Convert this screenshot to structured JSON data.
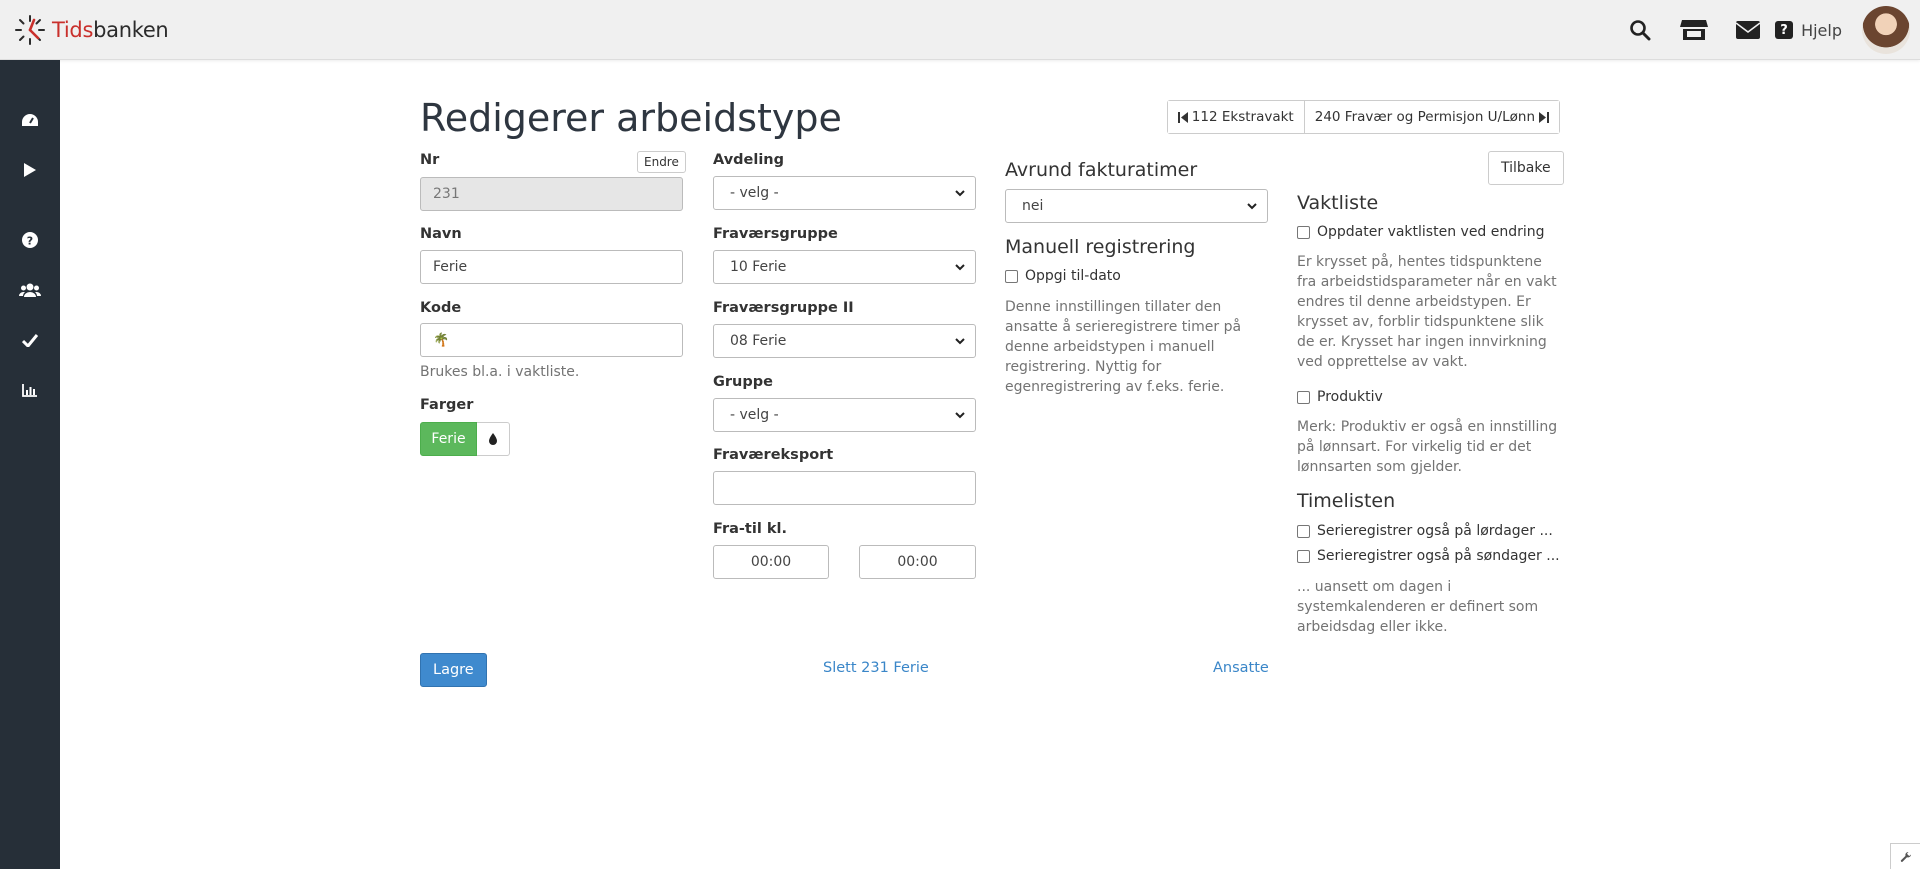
{
  "app": {
    "logo_prefix": "Tids",
    "logo_suffix": "banken",
    "help_label": "Hjelp"
  },
  "topbar": {
    "icons": [
      "search-icon",
      "store-icon",
      "mail-icon",
      "help-icon"
    ]
  },
  "sidebar": {
    "items": [
      "dashboard-icon",
      "play-icon",
      "help-circle-icon",
      "users-icon",
      "check-icon",
      "chart-icon"
    ]
  },
  "page": {
    "title": "Redigerer arbeidstype",
    "prev_label": "112 Ekstravakt",
    "next_label": "240 Fravær og Permisjon U/Lønn",
    "back_label": "Tilbake"
  },
  "form": {
    "nr_label": "Nr",
    "nr_value": "231",
    "endre_label": "Endre",
    "navn_label": "Navn",
    "navn_value": "Ferie",
    "kode_label": "Kode",
    "kode_value": "🌴",
    "kode_help": "Brukes bl.a. i vaktliste.",
    "farger_label": "Farger",
    "color_label": "Ferie",
    "color_value": "#5cb85c",
    "avdeling_label": "Avdeling",
    "avdeling_value": "- velg -",
    "fravaersgruppe_label": "Fraværsgruppe",
    "fravaersgruppe_value": "10 Ferie",
    "fravaersgruppe2_label": "Fraværsgruppe II",
    "fravaersgruppe2_value": "08 Ferie",
    "gruppe_label": "Gruppe",
    "gruppe_value": "- velg -",
    "eksport_label": "Fraværeksport",
    "eksport_value": "",
    "fratil_label": "Fra-til kl.",
    "fra_value": "00:00",
    "til_value": "00:00"
  },
  "billing": {
    "title": "Avrund fakturatimer",
    "value": "nei",
    "manual_title": "Manuell registrering",
    "manual_check": "Oppgi til-dato",
    "manual_help": "Denne innstillingen tillater den ansatte å serieregistrere timer på denne arbeidstypen i manuell registrering. Nyttig for egenregistrering av f.eks. ferie."
  },
  "vaktliste": {
    "title": "Vaktliste",
    "update_check": "Oppdater vaktlisten ved endring",
    "update_help": "Er krysset på, hentes tidspunktene fra arbeidstidsparameter når en vakt endres til denne arbeidstypen. Er krysset av, forblir tidspunktene slik de er. Krysset har ingen innvirkning ved opprettelse av vakt.",
    "produktiv_check": "Produktiv",
    "produktiv_help": "Merk: Produktiv er også en innstilling på lønnsart. For virkelig tid er det lønnsarten som gjelder."
  },
  "timelisten": {
    "title": "Timelisten",
    "saturday_check": "Serieregistrer også på lørdager ...",
    "sunday_check": "Serieregistrer også på søndager ...",
    "help": "... uansett om dagen i systemkalenderen er definert som arbeidsdag eller ikke."
  },
  "actions": {
    "save_label": "Lagre",
    "delete_label": "Slett 231 Ferie",
    "employees_label": "Ansatte"
  }
}
